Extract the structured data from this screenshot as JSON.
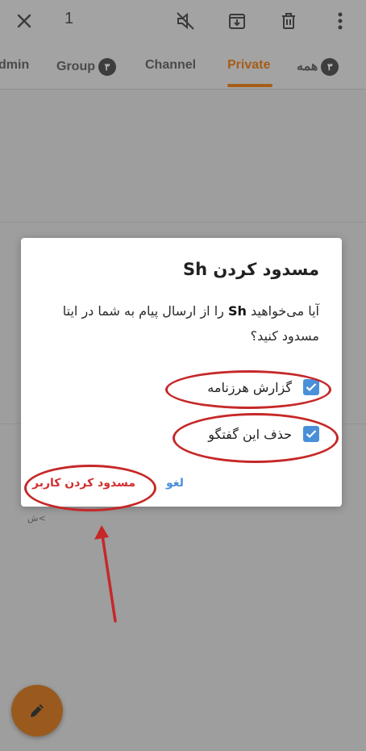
{
  "topbar": {
    "selected_count": "1",
    "icons": [
      "close-icon",
      "mute-icon",
      "archive-icon",
      "delete-icon",
      "more-vert-icon"
    ]
  },
  "tabs": [
    {
      "label": "dmin",
      "badge": ""
    },
    {
      "label": "Group",
      "badge": "۳"
    },
    {
      "label": "Channel",
      "badge": ""
    },
    {
      "label": "Private",
      "badge": "",
      "active": true
    },
    {
      "label": "همه",
      "badge": "۳"
    }
  ],
  "dialog": {
    "title": "مسدود کردن Sh",
    "message_pre": "آیا می‌خواهید ",
    "message_user": "Sh",
    "message_post": " را از ارسال پیام به شما در ایتا مسدود کنید؟",
    "options": [
      {
        "label": "گزارش هرزنامه",
        "checked": true
      },
      {
        "label": "حذف این گفتگو",
        "checked": true
      }
    ],
    "cancel_label": "لغو",
    "block_label": "مسدود کردن کاربر"
  },
  "background": {
    "snippet": "ش<"
  },
  "colors": {
    "accent": "#a65d18",
    "checkbox": "#4a90d9",
    "danger": "#d32f2f",
    "annotation": "#c62828"
  }
}
